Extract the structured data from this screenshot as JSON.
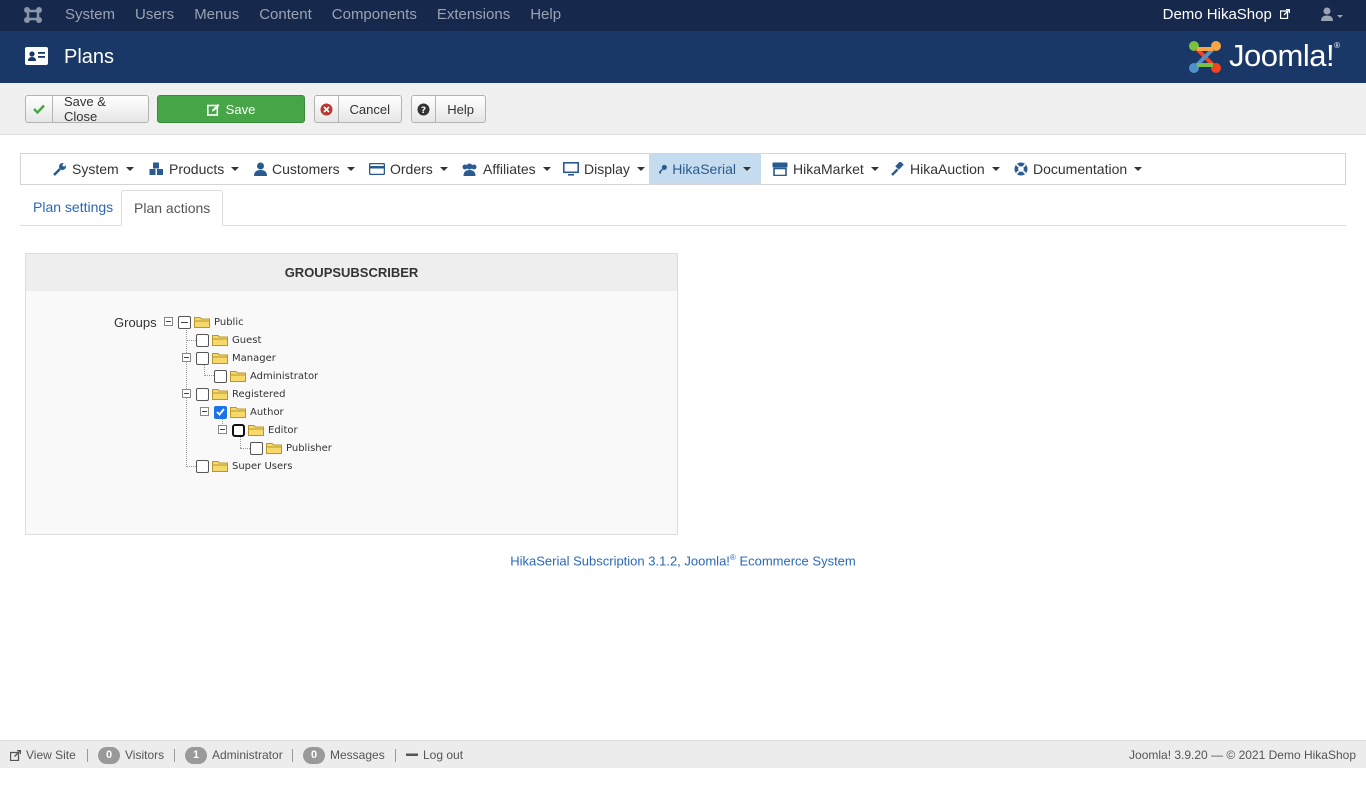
{
  "topnav": {
    "menu": [
      "System",
      "Users",
      "Menus",
      "Content",
      "Components",
      "Extensions",
      "Help"
    ],
    "site_name": "Demo HikaShop"
  },
  "header": {
    "title": "Plans",
    "brand": "Joomla!"
  },
  "toolbar": {
    "save_close": "Save & Close",
    "save": "Save",
    "cancel": "Cancel",
    "help": "Help"
  },
  "menubar": [
    {
      "label": "System",
      "icon": "wrench-icon"
    },
    {
      "label": "Products",
      "icon": "cubes-icon"
    },
    {
      "label": "Customers",
      "icon": "user-icon"
    },
    {
      "label": "Orders",
      "icon": "credit-card-icon"
    },
    {
      "label": "Affiliates",
      "icon": "users-icon"
    },
    {
      "label": "Display",
      "icon": "monitor-icon"
    },
    {
      "label": "HikaSerial",
      "icon": "key-icon",
      "active": true
    },
    {
      "label": "HikaMarket",
      "icon": "store-icon"
    },
    {
      "label": "HikaAuction",
      "icon": "gavel-icon"
    },
    {
      "label": "Documentation",
      "icon": "lifebuoy-icon"
    }
  ],
  "tabs": [
    "Plan settings",
    "Plan actions"
  ],
  "active_tab": "Plan actions",
  "panel": {
    "title": "GROUPSUBSCRIBER",
    "groups_label": "Groups",
    "tree": [
      {
        "label": "Public",
        "checked": false
      },
      {
        "label": "Guest",
        "checked": false
      },
      {
        "label": "Manager",
        "checked": false
      },
      {
        "label": "Administrator",
        "checked": false
      },
      {
        "label": "Registered",
        "checked": false
      },
      {
        "label": "Author",
        "checked": true
      },
      {
        "label": "Editor",
        "checked": false
      },
      {
        "label": "Publisher",
        "checked": false
      },
      {
        "label": "Super Users",
        "checked": false
      }
    ]
  },
  "credit": {
    "text": "HikaSerial Subscription 3.1.2, Joomla!",
    "reg": "®",
    "suffix": " Ecommerce System"
  },
  "statusbar": {
    "view_site": "View Site",
    "visitors_count": "0",
    "visitors": "Visitors",
    "admins_count": "1",
    "admins": "Administrator",
    "messages_count": "0",
    "messages": "Messages",
    "logout": "Log out",
    "version": "Joomla! 3.9.20",
    "copyright": "— © 2021 Demo HikaShop"
  },
  "colors": {
    "topnav_bg": "#17284d",
    "header_bg": "#1a3867",
    "save_green": "#46a546",
    "link_blue": "#2a69b8",
    "active_menu_bg": "#c5dcef"
  }
}
